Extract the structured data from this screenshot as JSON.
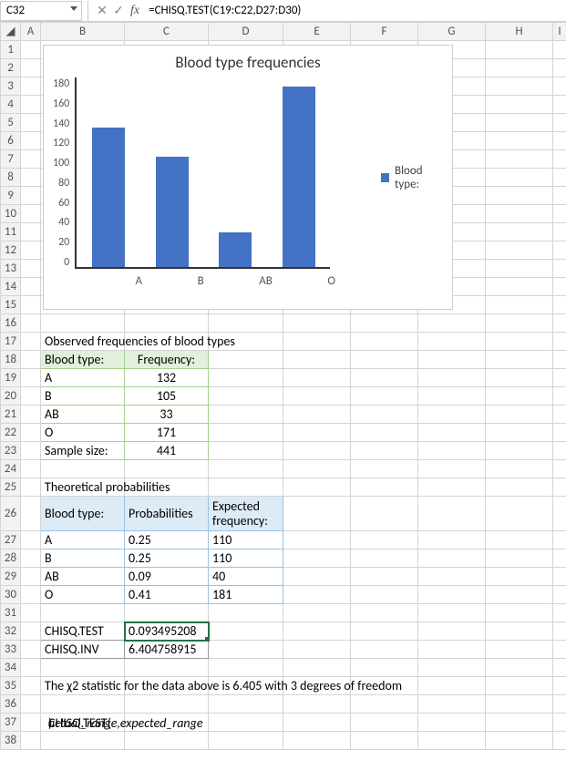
{
  "formula_bar": {
    "cell_ref": "C32",
    "formula": "=CHISQ.TEST(C19:C22,D27:D30)"
  },
  "columns": [
    "",
    "A",
    "B",
    "C",
    "D",
    "E",
    "F",
    "G",
    "H",
    "I"
  ],
  "rows": [
    1,
    2,
    3,
    4,
    5,
    6,
    7,
    8,
    9,
    10,
    11,
    12,
    13,
    14,
    15,
    16,
    17,
    18,
    19,
    20,
    21,
    22,
    23,
    24,
    25,
    26,
    27,
    28,
    29,
    30,
    31,
    32,
    33,
    34,
    35,
    36,
    37,
    38
  ],
  "chart_data": {
    "type": "bar",
    "title": "Blood type frequencies",
    "categories": [
      "A",
      "B",
      "AB",
      "O"
    ],
    "series": [
      {
        "name": "Blood type:",
        "values": [
          132,
          105,
          33,
          171
        ]
      }
    ],
    "ylim": [
      0,
      180
    ],
    "yticks": [
      180,
      160,
      140,
      120,
      100,
      80,
      60,
      40,
      20,
      0
    ],
    "legend_position": "right"
  },
  "table1": {
    "title": "Observed frequencies of blood types",
    "headers": [
      "Blood type:",
      "Frequency:"
    ],
    "rows": [
      [
        "A",
        "132"
      ],
      [
        "B",
        "105"
      ],
      [
        "AB",
        "33"
      ],
      [
        "O",
        "171"
      ]
    ],
    "footer": [
      "Sample size:",
      "441"
    ]
  },
  "table2": {
    "title": "Theoretical probabilities",
    "headers": [
      "Blood type:",
      "Probabilities",
      "Expected frequency:"
    ],
    "rows": [
      [
        "A",
        "0.25",
        "110"
      ],
      [
        "B",
        "0.25",
        "110"
      ],
      [
        "AB",
        "0.09",
        "40"
      ],
      [
        "O",
        "0.41",
        "181"
      ]
    ]
  },
  "results": {
    "chisq_test_label": "CHISQ.TEST",
    "chisq_test_value": "0.093495208",
    "chisq_inv_label": "CHISQ.INV",
    "chisq_inv_value": "6.404758915"
  },
  "note_line": "The χ2 statistic for the data above is 6.405 with 3 degrees of freedom",
  "syntax_line_prefix": "CHISQ.TEST(",
  "syntax_line_args": "actual_range,expected_range",
  "syntax_line_suffix": ")"
}
